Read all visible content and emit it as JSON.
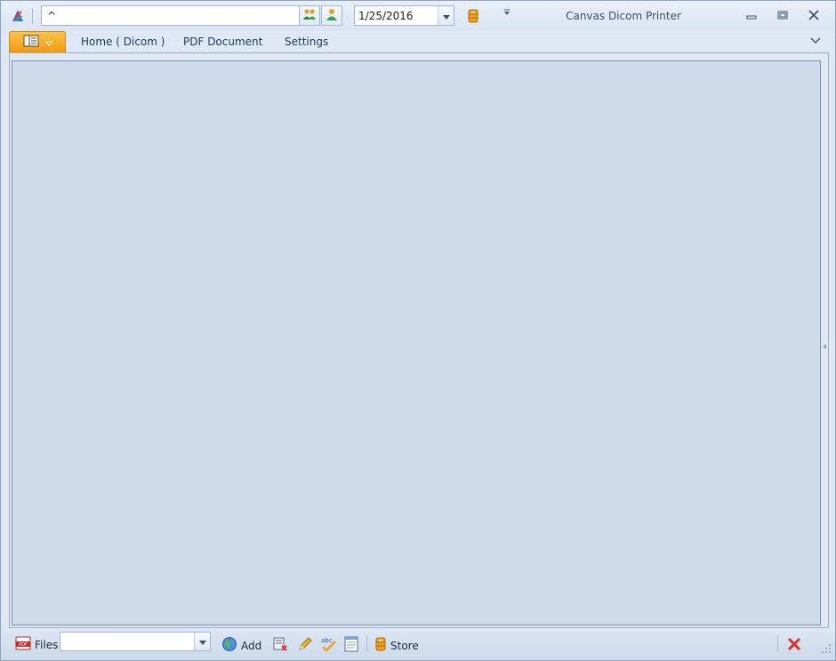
{
  "titlebar": {
    "search": {
      "value": "^",
      "placeholder": ""
    },
    "date": {
      "value": "1/25/2016"
    },
    "window_title": "Canvas Dicom Printer"
  },
  "ribbon": {
    "tabs": [
      {
        "label": "Home ( Dicom )"
      },
      {
        "label": "PDF Document"
      },
      {
        "label": "Settings"
      }
    ]
  },
  "statusbar": {
    "files_label": "Files",
    "files_value": "",
    "add_label": "Add",
    "store_label": "Store"
  },
  "colors": {
    "accent_orange": "#f29a10",
    "content_bg": "#cfdcec",
    "close_red": "#d9332b"
  },
  "icons": [
    "app-logo-icon",
    "group-users-icon",
    "user-icon",
    "chevron-down-icon",
    "database-icon",
    "customize-toolbar-icon",
    "minimize-icon",
    "restore-icon",
    "close-icon",
    "app-menu-icon",
    "ribbon-collapse-icon",
    "pdf-icon",
    "globe-icon",
    "remove-file-icon",
    "pencil-icon",
    "spell-check-icon",
    "document-icon",
    "resize-grip-icon"
  ]
}
